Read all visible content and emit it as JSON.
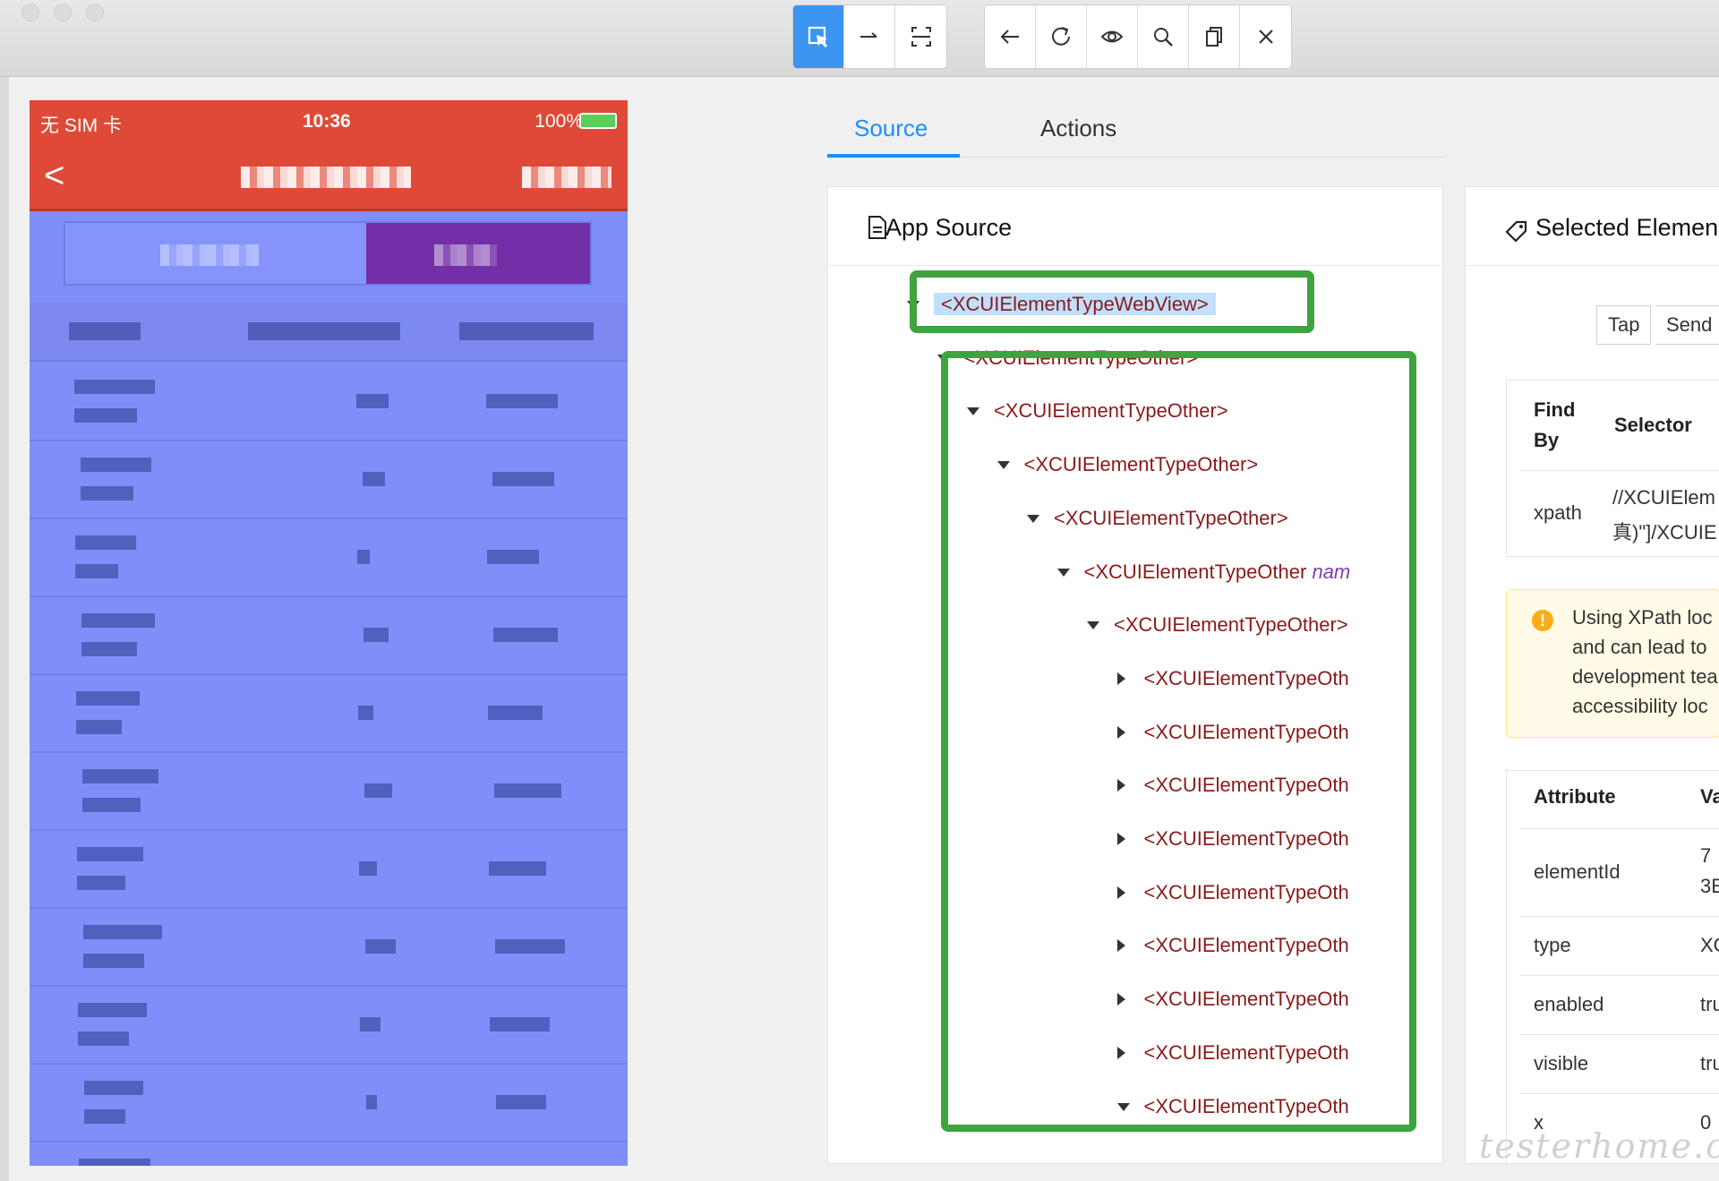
{
  "toolbar": {
    "group1": [
      {
        "icon": "select-element-icon",
        "active": true
      },
      {
        "icon": "swipe-arrow-icon",
        "active": false
      },
      {
        "icon": "tap-coordinates-icon",
        "active": false
      }
    ],
    "group2": [
      {
        "icon": "back-arrow-icon"
      },
      {
        "icon": "refresh-icon"
      },
      {
        "icon": "eye-icon"
      },
      {
        "icon": "search-icon"
      },
      {
        "icon": "copy-xml-icon"
      },
      {
        "icon": "close-icon"
      }
    ]
  },
  "phone": {
    "status_left": "无 SIM 卡",
    "status_time": "10:36",
    "status_battery": "100%",
    "back_label": "<"
  },
  "tabs": {
    "source": "Source",
    "actions": "Actions"
  },
  "app_source": {
    "title": "App Source",
    "nodes": [
      {
        "label": "<XCUIElementTypeWebView>",
        "caret": "down",
        "depth": 0,
        "selected": true
      },
      {
        "label": "<XCUIElementTypeOther>",
        "caret": "down",
        "depth": 1
      },
      {
        "label": "<XCUIElementTypeOther>",
        "caret": "down",
        "depth": 2
      },
      {
        "label": "<XCUIElementTypeOther>",
        "caret": "down",
        "depth": 3
      },
      {
        "label": "<XCUIElementTypeOther>",
        "caret": "down",
        "depth": 4
      },
      {
        "label": "<XCUIElementTypeOther ",
        "attr": "nam",
        "caret": "down",
        "depth": 5
      },
      {
        "label": "<XCUIElementTypeOther>",
        "caret": "down",
        "depth": 6
      },
      {
        "label": "<XCUIElementTypeOth",
        "caret": "right",
        "depth": 7
      },
      {
        "label": "<XCUIElementTypeOth",
        "caret": "right",
        "depth": 7
      },
      {
        "label": "<XCUIElementTypeOth",
        "caret": "right",
        "depth": 7
      },
      {
        "label": "<XCUIElementTypeOth",
        "caret": "right",
        "depth": 7
      },
      {
        "label": "<XCUIElementTypeOth",
        "caret": "right",
        "depth": 7
      },
      {
        "label": "<XCUIElementTypeOth",
        "caret": "right",
        "depth": 7
      },
      {
        "label": "<XCUIElementTypeOth",
        "caret": "right",
        "depth": 7
      },
      {
        "label": "<XCUIElementTypeOth",
        "caret": "right",
        "depth": 7
      },
      {
        "label": "<XCUIElementTypeOth",
        "caret": "down",
        "depth": 7
      }
    ]
  },
  "selected_element": {
    "title": "Selected Elemen",
    "buttons": [
      "Tap",
      "Send"
    ],
    "selector_table": {
      "headers": [
        "Find By",
        "Selector"
      ],
      "find_by_line1": "Find",
      "find_by_line2": "By",
      "row_key": "xpath",
      "row_value_line1": "//XCUIElem",
      "row_value_line2": "真)\"]/XCUIE"
    },
    "warning_lines": [
      "Using XPath loc",
      "and can lead to",
      "development tea",
      "accessibility loc"
    ],
    "attributes": {
      "header_attr": "Attribute",
      "header_val": "Va",
      "rows": [
        {
          "name": "elementId",
          "value_line1": "7",
          "value_line2": "3E"
        },
        {
          "name": "type",
          "value_line1": "XC"
        },
        {
          "name": "enabled",
          "value_line1": "tru"
        },
        {
          "name": "visible",
          "value_line1": "tru"
        },
        {
          "name": "x",
          "value_line1": "0"
        }
      ]
    }
  },
  "watermark": "testerhome.com",
  "colors": {
    "accent": "#1990ff",
    "highlight_box": "#3fa33f",
    "phone_overlay": "#7f8ef9",
    "nav_red": "#df4a38",
    "node_text": "#8b1a1a"
  }
}
